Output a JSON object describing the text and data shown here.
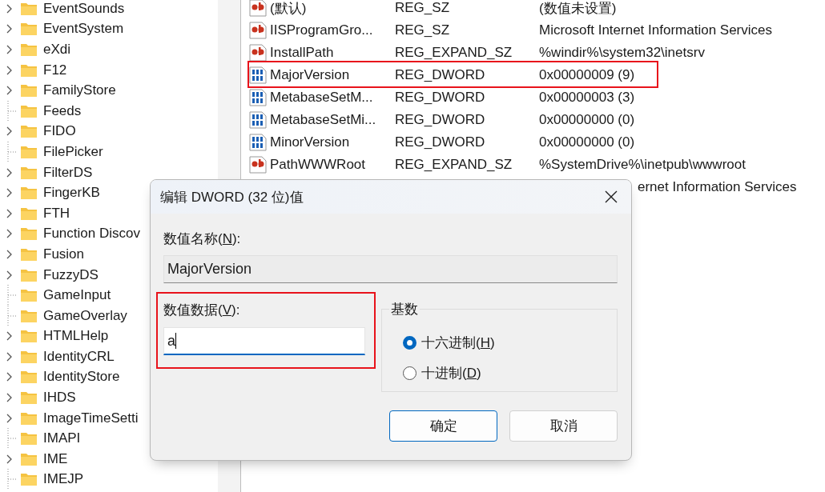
{
  "tree": {
    "items": [
      {
        "label": "EventSounds",
        "has_children": true
      },
      {
        "label": "EventSystem",
        "has_children": true
      },
      {
        "label": "eXdi",
        "has_children": true
      },
      {
        "label": "F12",
        "has_children": true
      },
      {
        "label": "FamilyStore",
        "has_children": true
      },
      {
        "label": "Feeds",
        "has_children": false
      },
      {
        "label": "FIDO",
        "has_children": true
      },
      {
        "label": "FilePicker",
        "has_children": false
      },
      {
        "label": "FilterDS",
        "has_children": true
      },
      {
        "label": "FingerKB",
        "has_children": true
      },
      {
        "label": "FTH",
        "has_children": true
      },
      {
        "label": "Function Discov",
        "has_children": true
      },
      {
        "label": "Fusion",
        "has_children": true
      },
      {
        "label": "FuzzyDS",
        "has_children": true
      },
      {
        "label": "GameInput",
        "has_children": false
      },
      {
        "label": "GameOverlay",
        "has_children": false
      },
      {
        "label": "HTMLHelp",
        "has_children": true
      },
      {
        "label": "IdentityCRL",
        "has_children": true
      },
      {
        "label": "IdentityStore",
        "has_children": true
      },
      {
        "label": "IHDS",
        "has_children": true
      },
      {
        "label": "ImageTimeSetti",
        "has_children": true
      },
      {
        "label": "IMAPI",
        "has_children": false
      },
      {
        "label": "IME",
        "has_children": true
      },
      {
        "label": "IMEJP",
        "has_children": false
      }
    ]
  },
  "values": {
    "rows": [
      {
        "kind": "string",
        "name": "(默认)",
        "type": "REG_SZ",
        "data": "(数值未设置)",
        "highlighted": false
      },
      {
        "kind": "string",
        "name": "IISProgramGro...",
        "type": "REG_SZ",
        "data": "Microsoft Internet Information Services",
        "highlighted": false
      },
      {
        "kind": "string",
        "name": "InstallPath",
        "type": "REG_EXPAND_SZ",
        "data": "%windir%\\system32\\inetsrv",
        "highlighted": false
      },
      {
        "kind": "dword",
        "name": "MajorVersion",
        "type": "REG_DWORD",
        "data": "0x00000009 (9)",
        "highlighted": true
      },
      {
        "kind": "dword",
        "name": "MetabaseSetM...",
        "type": "REG_DWORD",
        "data": "0x00000003 (3)",
        "highlighted": false
      },
      {
        "kind": "dword",
        "name": "MetabaseSetMi...",
        "type": "REG_DWORD",
        "data": "0x00000000 (0)",
        "highlighted": false
      },
      {
        "kind": "dword",
        "name": "MinorVersion",
        "type": "REG_DWORD",
        "data": "0x00000000 (0)",
        "highlighted": false
      },
      {
        "kind": "string",
        "name": "PathWWWRoot",
        "type": "REG_EXPAND_SZ",
        "data": "%SystemDrive%\\inetpub\\wwwroot",
        "highlighted": false
      },
      {
        "kind": "covered",
        "data": "ernet Information Services"
      }
    ]
  },
  "dialog": {
    "title": "编辑 DWORD (32 位)值",
    "name_label": {
      "before": "数值名称(",
      "accel": "N",
      "after": "):"
    },
    "name_value": "MajorVersion",
    "data_label": {
      "before": "数值数据(",
      "accel": "V",
      "after": "):"
    },
    "data_value": "a",
    "data_focused": true,
    "data_highlighted": true,
    "base": {
      "legend": "基数",
      "options": [
        {
          "before": "十六进制(",
          "accel": "H",
          "after": ")",
          "selected": true
        },
        {
          "before": "十进制(",
          "accel": "D",
          "after": ")",
          "selected": false
        }
      ]
    },
    "buttons": [
      {
        "label": "确定",
        "default": true
      },
      {
        "label": "取消",
        "default": false
      }
    ]
  }
}
